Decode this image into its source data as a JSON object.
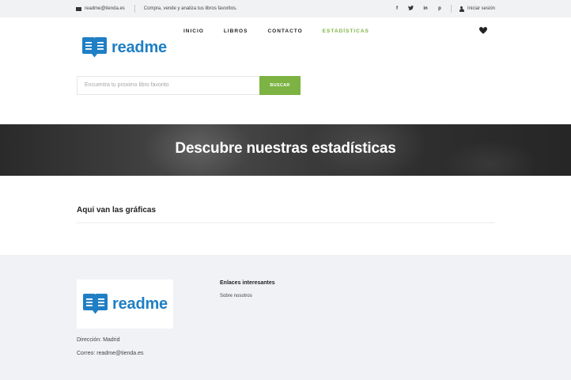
{
  "topbar": {
    "email": "readme@tienda.es",
    "tagline": "Compra, vende y analiza tus libros favoritos.",
    "social": [
      "f",
      "t",
      "in",
      "p"
    ],
    "login_label": "Iniciar sesión",
    "icons": [
      "mail-icon",
      "facebook-icon",
      "twitter-icon",
      "linkedin-icon",
      "pinterest-icon",
      "user-icon"
    ]
  },
  "header": {
    "logo_text": "readme",
    "brand_color": "#1f7fc4",
    "nav": [
      {
        "label": "INICIO",
        "active": false
      },
      {
        "label": "LIBROS",
        "active": false
      },
      {
        "label": "CONTACTO",
        "active": false
      },
      {
        "label": "ESTADÍSTICAS",
        "active": true
      }
    ],
    "accent_color": "#7cb342",
    "wishlist_icon": "heart-icon"
  },
  "search": {
    "placeholder": "Encuentra tu proximo libro favorito",
    "button_label": "BUSCAR"
  },
  "banner": {
    "title": "Descubre nuestras estadísticas"
  },
  "main": {
    "section_title": "Aqui van las gráficas"
  },
  "footer": {
    "logo_text": "readme",
    "address": "Dirección: Madrid",
    "email": "Correo: readme@tienda.es",
    "links_title": "Enlaces interesantes",
    "links": [
      "Sobre nosotros"
    ]
  }
}
